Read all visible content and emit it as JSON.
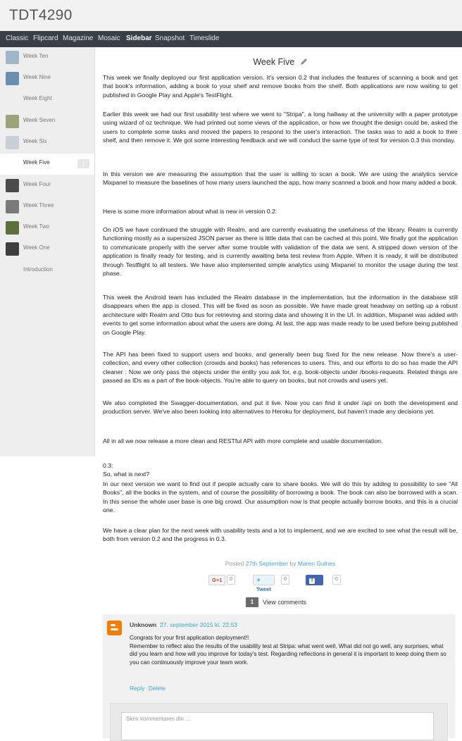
{
  "header": {
    "title": "TDT4290"
  },
  "nav": {
    "items": [
      {
        "label": "Classic"
      },
      {
        "label": "Flipcard"
      },
      {
        "label": "Magazine"
      },
      {
        "label": "Mosaic"
      },
      {
        "label": "Sidebar",
        "active": true
      },
      {
        "label": "Snapshot"
      },
      {
        "label": "Timeslide"
      }
    ]
  },
  "sidebar": {
    "items": [
      {
        "label": "Week Ten",
        "thumb": "#9fb7c9"
      },
      {
        "label": "Week Nine",
        "thumb": "#6c8fb0"
      },
      {
        "label": "Week Eight",
        "thumb": ""
      },
      {
        "label": "Week Seven",
        "thumb": "#9aa478"
      },
      {
        "label": "Week Six",
        "thumb": "#c9cfd6"
      },
      {
        "label": "Week Five",
        "active": true,
        "badge": "1"
      },
      {
        "label": "Week Four",
        "thumb": "#4a4a4a"
      },
      {
        "label": "Week Three",
        "thumb": "#7a7a7a"
      },
      {
        "label": "Week Two",
        "thumb": "#5d6f3f"
      },
      {
        "label": "Week One",
        "thumb": "#3e3e3e"
      },
      {
        "label": "Introduction",
        "thumb": ""
      }
    ]
  },
  "post": {
    "title": "Week Five",
    "paragraphs": [
      "This week we finally deployed our first application version. It's version 0.2 that includes the features of scanning a book and get that book's information, adding a book to your shelf and remove books from the shelf. Both applications are now waiting to get published in Google Play and Apple's TestFlight.",
      "Earlier this week we had our first usability test where we went to \"Stripa\", a long hallway at the university with a paper prototype using wizard of oz technique. We had printed out some views of the application, or how we thought the design could be, asked the users to complete some tasks and moved the papers to respond to the user's interaction. The tasks was to add a book to their shelf, and then remove it. We got some interesting feedback and we will conduct the same type of test for version 0.3 this monday.",
      "In this version we are measuring the assumption that the user is willing to scan a book. We are using the analytics service Mixpanel to measure the baselines of how many users launched the app, how many scanned a book and how many added a book.",
      "Here is some more information about what is new in version 0.2:",
      "On iOS we have continued the struggle with Realm, and are currently evaluating the usefulness of the library. Realm is currently functioning mostly as a supersized JSON parser as there is little data that can be cached at this point. We finally got the application to communicate properly with the server after some trouble with validation of the data we sent. A stripped down version of the application is finally ready for testing, and is currently awaiting beta test review from Apple. When it is ready, it will be distributed through Testflight to all testers. We have also implemented simple analytics using Mixpanel to monitor the usage during the test phase.",
      "This week the Android team has included the Realm database in the implementation, but the information in the database still disappears when the app is closed. This will be fixed as soon as possible. We have made great headway on setting up a robust architecture with Realm and Otto bus for retrieving and storing data and showing it in the UI. In addition, Mixpanel was added with events to get some information about what the users are doing. At last, the app was made ready to be used before being published on Google Play.",
      "The API has been fixed to support users and books, and generally been bug fixed for the new release. Now there's a user-collection, and every other collection (crowds and books) has references to users. This, and our efforts to do so has made the API cleaner : Now we only pass the objects under the entity you ask for, e.g. book-objects under /books-requests. Related things are passed as IDs as a part of the book-objects. You're able to query on books, but not crowds and users yet.",
      "We also completed the Swagger-documentation, and put it live. Now you can find it under /api on both the development and production server. We've also been looking into alternatives to Heroku for deployment, but haven't made any decisions yet.",
      "All in all we now release a more clean and RESTful API with more complete and usable documentation.",
      "0.3:",
      "So, what is next?",
      "In our next version we want to find out if people actually care to share books. We will do this by adding to possibility to see \"All Books\", all the books in the system, and of course the possibility of borrowing a book. The book can also be borrowed with a scan. In this sense the whole user base is one big crowd. Our assumption now is that people actually borrow books, and this is a crucial one.",
      "We have a clear plan for the next week with usability tests and a lot to implement, and we are excited to see what the result will be, both from version 0.2 and the progress in 0.3."
    ],
    "meta": {
      "posted": "Posted",
      "date": "27th September",
      "by": "by",
      "author": "Maren Gulnes"
    }
  },
  "share": {
    "gplus": {
      "label": "G+1",
      "count": "0"
    },
    "tweet": {
      "label": "Tweet",
      "count": "0"
    },
    "like": {
      "label": "Like",
      "count": "0"
    }
  },
  "comments": {
    "count": "1",
    "toggle_label": "View comments",
    "items": [
      {
        "author": "Unknown",
        "date": "27. september 2015 kl. 22.53",
        "lines": [
          "Congrats for your first application deployment!!",
          "Remember to reflect also the results of the usability test at Stripa: what went well, What did not go well, any surprises, what did you learn and how will you improve for today's test. Regarding reflections in general it is important to keep doing them so you can continuously improve your team work."
        ],
        "reply": "Reply",
        "delete": "Delete"
      }
    ],
    "input_placeholder": "Skriv kommentaren din ..."
  },
  "colors": {
    "accent": "#3aa9c9",
    "nav_bg": "#3a3f45",
    "blogger_orange": "#f57d00"
  }
}
